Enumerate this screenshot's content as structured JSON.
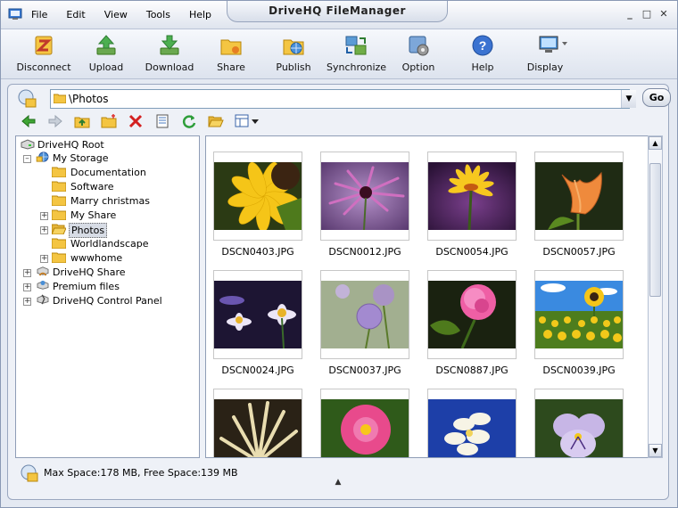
{
  "app": {
    "title": "DriveHQ FileManager",
    "menu": [
      "File",
      "Edit",
      "View",
      "Tools",
      "Help"
    ],
    "window_controls": [
      "minimize-icon",
      "maximize-icon",
      "close-icon"
    ]
  },
  "toolbar": [
    {
      "label": "Disconnect",
      "icon": "disconnect-icon"
    },
    {
      "label": "Upload",
      "icon": "upload-icon"
    },
    {
      "label": "Download",
      "icon": "download-icon"
    },
    {
      "label": "Share",
      "icon": "share-icon"
    },
    {
      "label": "Publish",
      "icon": "publish-icon"
    },
    {
      "label": "Synchronize",
      "icon": "synchronize-icon"
    },
    {
      "label": "Option",
      "icon": "option-icon"
    },
    {
      "label": "Help",
      "icon": "help-icon"
    },
    {
      "label": "Display",
      "icon": "display-icon"
    }
  ],
  "address": {
    "path": "\\Photos",
    "go_label": "Go"
  },
  "subtoolbar": [
    "back-icon",
    "forward-icon",
    "up-folder-icon",
    "new-folder-icon",
    "delete-icon",
    "properties-icon",
    "refresh-icon",
    "open-folder-icon",
    "view-mode-icon"
  ],
  "tree": {
    "root": "DriveHQ Root",
    "my_storage": "My Storage",
    "children": [
      "Documentation",
      "Software",
      "Marry christmas",
      "My Share",
      "Photos",
      "Worldlandscape",
      "wwwhome"
    ],
    "selected": "Photos",
    "share": "DriveHQ Share",
    "premium": "Premium files",
    "control_panel": "DriveHQ Control Panel"
  },
  "files": [
    {
      "name": "DSCN0403.JPG"
    },
    {
      "name": "DSCN0012.JPG"
    },
    {
      "name": "DSCN0054.JPG"
    },
    {
      "name": "DSCN0057.JPG"
    },
    {
      "name": "DSCN0024.JPG"
    },
    {
      "name": "DSCN0037.JPG"
    },
    {
      "name": "DSCN0887.JPG"
    },
    {
      "name": "DSCN0039.JPG"
    },
    {
      "name": ""
    },
    {
      "name": ""
    },
    {
      "name": ""
    },
    {
      "name": ""
    }
  ],
  "status": {
    "text": "Max Space:178 MB, Free Space:139 MB"
  },
  "colors": {
    "window_bg": "#e4e9f2",
    "border": "#8a99b4"
  }
}
